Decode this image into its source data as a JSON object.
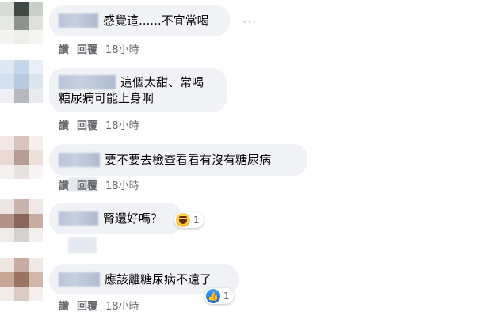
{
  "comments": [
    {
      "text": "感覺這......不宜常喝",
      "actions": {
        "like": "讚",
        "reply": "回覆",
        "time": "18小時"
      },
      "more": "···"
    },
    {
      "line1": "這個太甜、常喝",
      "line2": "糖尿病可能上身啊",
      "actions": {
        "like": "讚",
        "reply": "回覆",
        "time": "18小時"
      }
    },
    {
      "text": "要不要去檢查看看有沒有糖尿病",
      "actions": {
        "like": "讚",
        "reply": "回覆",
        "time": "18小時"
      }
    },
    {
      "text": "腎還好嗎？",
      "actions": {
        "like": "讚",
        "reply": "回覆",
        "time": "18小時"
      },
      "reaction": {
        "icon": "haha-icon",
        "count": "1"
      }
    },
    {
      "text": "應該離糖尿病不遠了",
      "actions": {
        "like": "讚",
        "reply": "回覆",
        "time": "18小時"
      },
      "reaction": {
        "icon": "like-icon",
        "count": "1"
      }
    }
  ]
}
